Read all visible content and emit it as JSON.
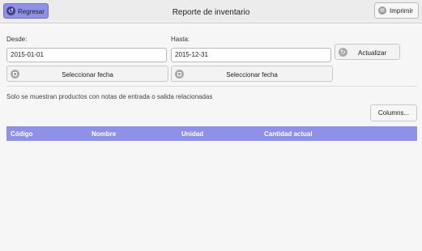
{
  "header": {
    "back_label": "Regresar",
    "title": "Reporte de inventario",
    "print_label": "Imprimir"
  },
  "filters": {
    "from_label": "Desde:",
    "from_value": "2015-01-01",
    "to_label": "Hasta:",
    "to_value": "2015-12-31",
    "select_date_label": "Seleccionar fecha",
    "update_label": "Actualizar"
  },
  "note": "Solo se muestran productos con notas de entrada o salida relacionadas",
  "columns_button": "Columns...",
  "table": {
    "columns": [
      "Código",
      "Nombre",
      "Unidad",
      "Cantidad actual"
    ],
    "rows": []
  },
  "colors": {
    "accent": "#8f91e8",
    "background": "#f6f6f6"
  }
}
